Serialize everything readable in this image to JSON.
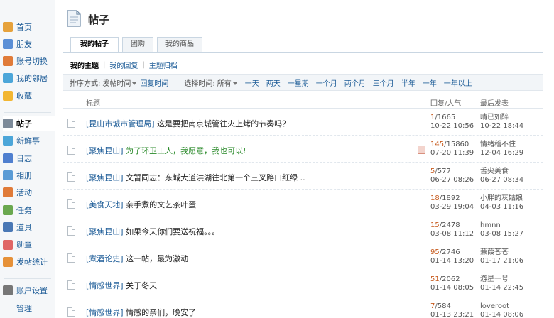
{
  "sidebar": {
    "items": [
      {
        "label": "首页",
        "icon": "home-icon",
        "color": "#e6a23c"
      },
      {
        "label": "朋友",
        "icon": "friends-icon",
        "color": "#5b8fd6"
      },
      {
        "label": "账号切换",
        "icon": "switch-account-icon",
        "color": "#e07b39"
      },
      {
        "label": "我的邻居",
        "icon": "chat-bubble-icon",
        "color": "#4ca6d9"
      },
      {
        "label": "收藏",
        "icon": "star-icon",
        "color": "#f2b632"
      },
      {
        "label": "帖子",
        "icon": "document-icon",
        "color": "#7c8a99"
      },
      {
        "label": "新鲜事",
        "icon": "speech-icon",
        "color": "#4ca6d9"
      },
      {
        "label": "日志",
        "icon": "journal-icon",
        "color": "#4f7fcf"
      },
      {
        "label": "相册",
        "icon": "photo-icon",
        "color": "#5a9bd5"
      },
      {
        "label": "活动",
        "icon": "activity-icon",
        "color": "#e07b39"
      },
      {
        "label": "任务",
        "icon": "task-icon",
        "color": "#6aa84f"
      },
      {
        "label": "道具",
        "icon": "tool-icon",
        "color": "#4a78b5"
      },
      {
        "label": "勋章",
        "icon": "medal-icon",
        "color": "#e06666"
      },
      {
        "label": "发帖统计",
        "icon": "stats-icon",
        "color": "#e69138"
      },
      {
        "label": "账户设置",
        "icon": "gear-icon",
        "color": "#777777"
      },
      {
        "label": "管理",
        "icon": "",
        "color": ""
      }
    ]
  },
  "page": {
    "title": "帖子"
  },
  "tabs": [
    "我的帖子",
    "团购",
    "我的商品"
  ],
  "subnav": [
    "我的主题",
    "我的回复",
    "主题归档"
  ],
  "filter": {
    "sort_label": "排序方式:",
    "sort_value": "发帖时间",
    "sort_alt": "回复时间",
    "time_label": "选择时间:",
    "time_value": "所有",
    "ranges": [
      "一天",
      "两天",
      "一星期",
      "一个月",
      "两个月",
      "三个月",
      "半年",
      "一年",
      "一年以上"
    ]
  },
  "table": {
    "headers": {
      "title": "标题",
      "stats": "回复/人气",
      "last": "最后发表"
    },
    "rows": [
      {
        "forum": "[昆山市城市管理局]",
        "subject": "这是要把南京城管往火上烤的节奏吗？",
        "replies": "1",
        "views": "/1665",
        "date": "10-22 10:56",
        "last_user": "晴已如醉",
        "last_date": "10-22 18:44"
      },
      {
        "forum": "[聚焦昆山]",
        "subject": "为了环卫工人，我愿意，我也可以!",
        "replies": "145",
        "views": "/15860",
        "date": "07-20 11:39",
        "last_user": "情绪稽不住",
        "last_date": "12-04 16:29"
      },
      {
        "forum": "[聚焦昆山]",
        "subject": "文暂同志：东城大道洪湖往北第一个三叉路口红绿 ..",
        "replies": "5",
        "views": "/577",
        "date": "06-27 08:26",
        "last_user": "舌尖美食",
        "last_date": "06-27 08:34"
      },
      {
        "forum": "[美食天地]",
        "subject": "亲手煮的文艺茶叶蛋",
        "replies": "18",
        "views": "/1892",
        "date": "03-29 19:04",
        "last_user": "小胖的灰姑娘",
        "last_date": "04-03 11:16"
      },
      {
        "forum": "[聚焦昆山]",
        "subject": "如果今天你们要送祝福。。。",
        "replies": "15",
        "views": "/2478",
        "date": "03-08 11:12",
        "last_user": "hmnn",
        "last_date": "03-08 15:27"
      },
      {
        "forum": "[煮酒论史]",
        "subject": "这一帖，最为激动",
        "replies": "95",
        "views": "/2746",
        "date": "01-14 13:20",
        "last_user": "蒹葭苍苍",
        "last_date": "01-17 21:06"
      },
      {
        "forum": "[情感世界]",
        "subject": "关于冬天",
        "replies": "51",
        "views": "/2062",
        "date": "01-14 08:05",
        "last_user": "游星一号",
        "last_date": "01-14 22:45"
      },
      {
        "forum": "[情感世界]",
        "subject": "情感的亲们，晚安了",
        "replies": "7",
        "views": "/584",
        "date": "01-13 23:21",
        "last_user": "loveroot",
        "last_date": "01-14 08:06"
      }
    ]
  }
}
